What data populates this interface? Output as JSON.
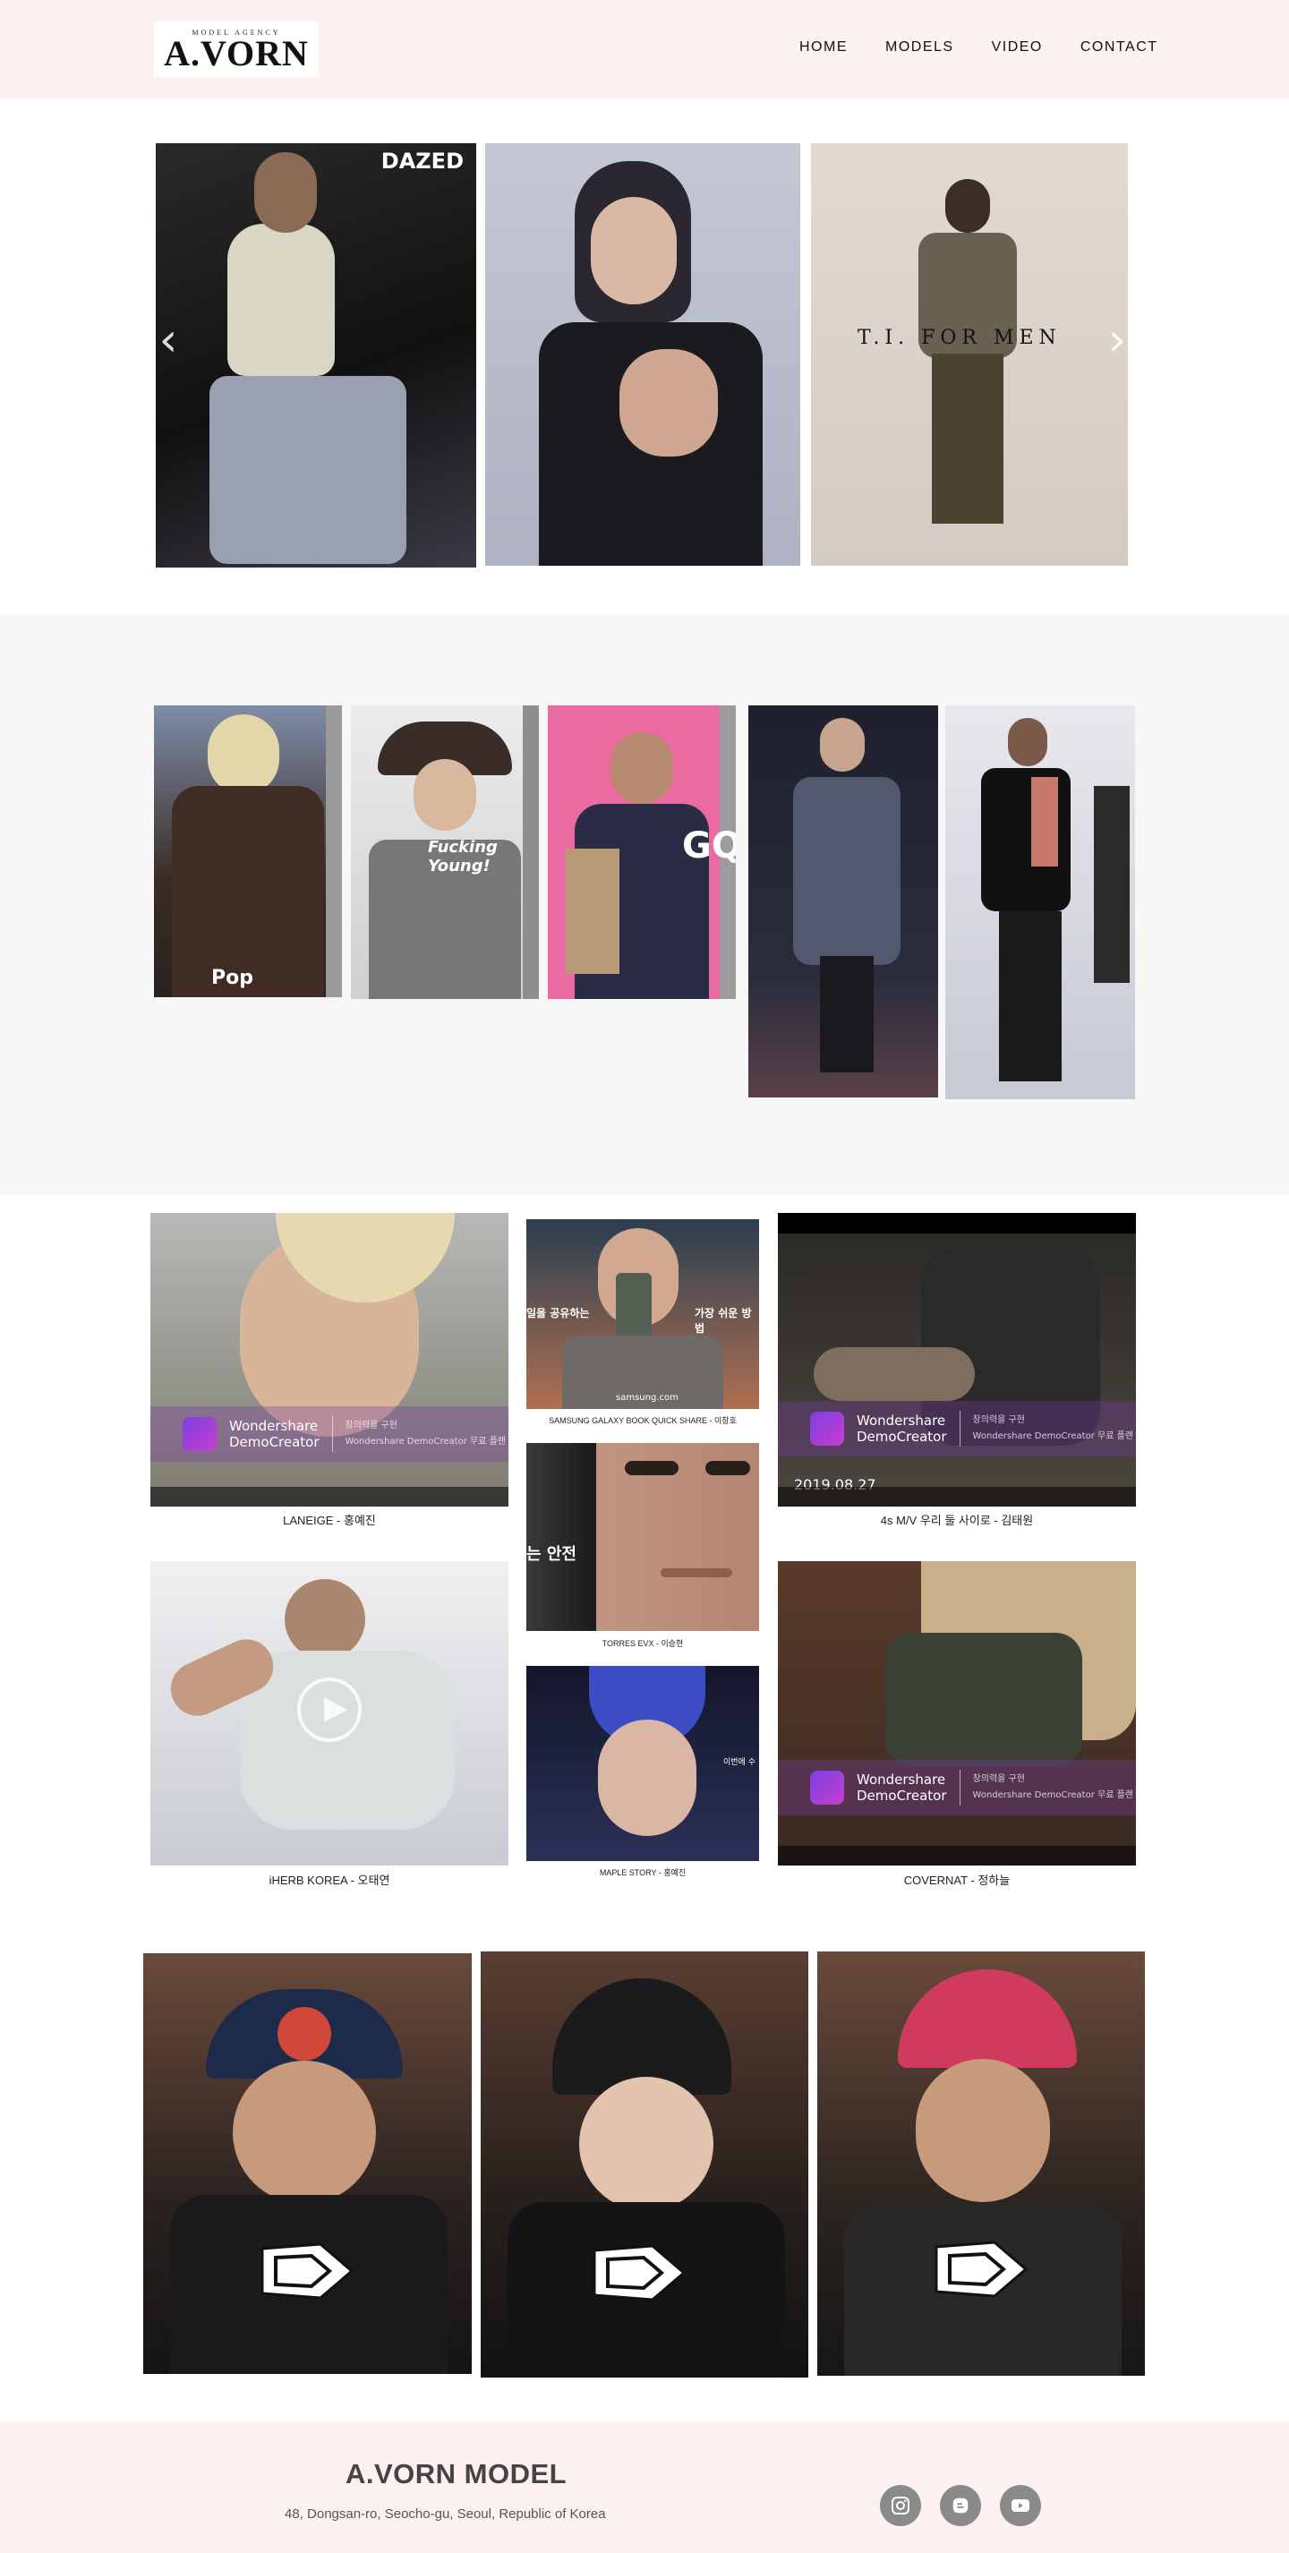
{
  "header": {
    "logo_small": "MODEL AGENCY",
    "logo_text": "A.VORN",
    "nav": [
      "HOME",
      "MODELS",
      "VIDEO",
      "CONTACT"
    ]
  },
  "hero": {
    "slides": [
      {
        "magazine": "DAZED",
        "color": "#1c1c1c"
      },
      {
        "magazine": "",
        "color": "#b9bccb"
      },
      {
        "magazine": "T.I. FOR MEN",
        "color": "#d8d0c8"
      }
    ],
    "prev_icon": "chevron-left-icon",
    "next_icon": "chevron-right-icon"
  },
  "gallery": {
    "items": [
      {
        "overlay": "Pop",
        "color": "#6f7d97"
      },
      {
        "overlay": "Fucking Young!",
        "color": "#8f8f88"
      },
      {
        "overlay": "GQ",
        "color": "#e86aa0"
      },
      {
        "overlay": "",
        "color": "#2c2e3a"
      },
      {
        "overlay": "",
        "color": "#cfd2da"
      }
    ]
  },
  "videos": {
    "watermark_brand_line1": "Wondershare",
    "watermark_brand_line2": "DemoCreator",
    "watermark_note_line1": "창의력을 구현",
    "watermark_note_line2": "Wondershare DemoCreator 무료 플랜",
    "items": [
      {
        "caption": "LANEIGE - 홍예진"
      },
      {
        "caption": "SAMSUNG GALAXY BOOK QUICK SHARE - 이창호",
        "overlay_left": "일을 공유하는",
        "overlay_right": "가장 쉬운 방법",
        "site": "samsung.com"
      },
      {
        "caption": "4s M/V 우리 둘 사이로 - 김태원",
        "date": "2019.08.27"
      },
      {
        "caption": "TORRES EVX - 이승현",
        "overlay_left": "는 안전"
      },
      {
        "caption": "iHERB KOREA - 오태연"
      },
      {
        "caption": "MAPLE STORY - 홍예진"
      },
      {
        "caption": "COVERNAT - 정하늘"
      }
    ]
  },
  "newera": {
    "items": [
      {
        "color": "#3b2a26"
      },
      {
        "color": "#2b2624"
      },
      {
        "color": "#3a2e29"
      }
    ]
  },
  "footer": {
    "name": "A.VORN MODEL",
    "address": "48, Dongsan-ro, Seocho-gu, Seoul, Republic of Korea",
    "social": [
      "instagram-icon",
      "blog-icon",
      "youtube-icon"
    ]
  }
}
